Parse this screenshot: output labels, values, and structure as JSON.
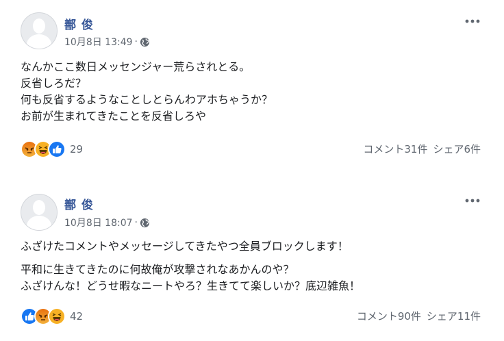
{
  "colors": {
    "author": "#385898",
    "meta": "#606770",
    "text": "#1c1e21",
    "like": "#1877f2",
    "angry": "#e9710f",
    "haha": "#f7b125"
  },
  "posts": [
    {
      "author": "鄯 俊",
      "date": "10月8日 13:49",
      "privacy_icon": "globe-icon",
      "body_lines": [
        "なんかここ数日メッセンジャー荒らされとる。",
        "反省しろだ？",
        "何も反省するようなことしとらんわアホちゃうか？",
        "お前が生まれてきたことを反省しろや"
      ],
      "reactions": [
        "angry",
        "haha",
        "like"
      ],
      "reaction_count": "29",
      "comments": "コメント31件",
      "shares": "シェア6件"
    },
    {
      "author": "鄯 俊",
      "date": "10月8日 18:07",
      "privacy_icon": "globe-icon",
      "body_lines": [
        "ふざけたコメントやメッセージしてきたやつ全員ブロックします！",
        "平和に生きてきたのに何故俺が攻撃されなあかんのや？",
        "ふざけんな！どうせ暇なニートやろ？生きてて楽しいか？底辺雑魚！"
      ],
      "reactions": [
        "like",
        "angry",
        "haha"
      ],
      "reaction_count": "42",
      "comments": "コメント90件",
      "shares": "シェア11件"
    }
  ]
}
